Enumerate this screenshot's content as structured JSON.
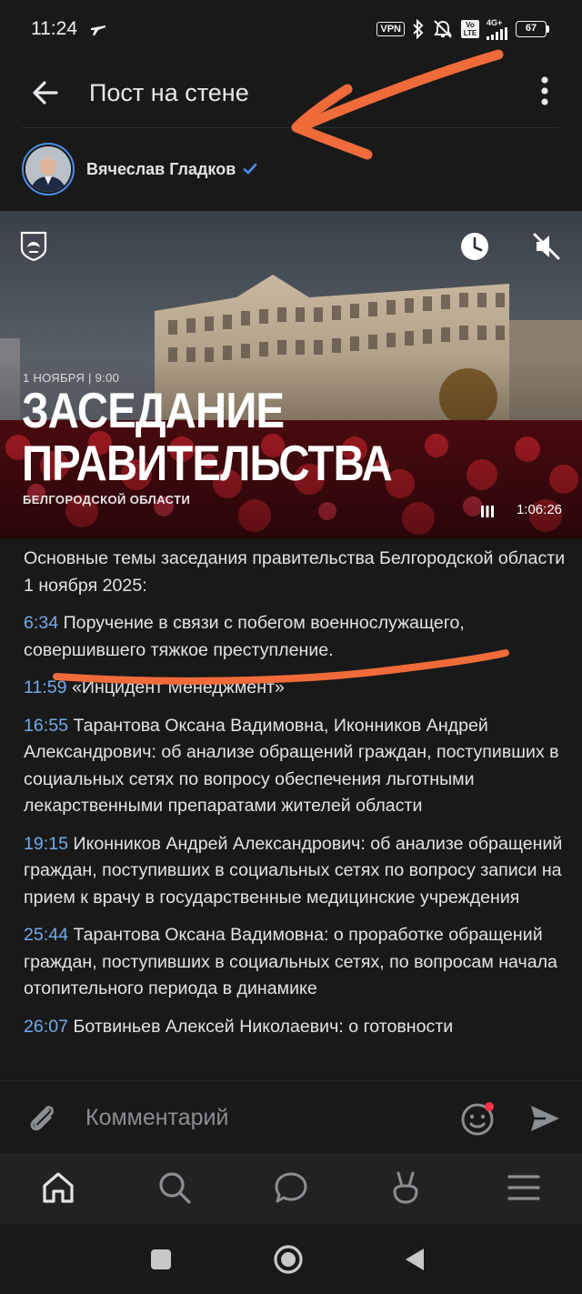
{
  "status_bar": {
    "time": "11:24",
    "vpn": "VPN",
    "volte": "Vo LTE",
    "network": "4G+",
    "battery": "67"
  },
  "header": {
    "title": "Пост на стене"
  },
  "author": {
    "name": "Вячеслав Гладков"
  },
  "video": {
    "date": "1 НОЯБРЯ | 9:00",
    "title_line1": "ЗАСЕДАНИЕ",
    "title_line2": "ПРАВИТЕЛЬСТВА",
    "subtitle": "БЕЛГОРОДСКОЙ ОБЛАСТИ",
    "duration": "1:06:26"
  },
  "post": {
    "intro": "Основные темы заседания правительства Белгородской области 1 ноября 2025:",
    "items": [
      {
        "time": "6:34",
        "text": " Поручение в связи с побегом военнослужащего, совершившего тяжкое преступление."
      },
      {
        "time": "11:59",
        "text": " «Инцидент Менеджмент»"
      },
      {
        "time": "16:55",
        "text": " Тарантова Оксана Вадимовна, Иконников Андрей Александрович: об анализе обращений граждан, поступивших в социальных сетях по вопросу обеспечения льготными лекарственными препаратами жителей области"
      },
      {
        "time": "19:15",
        "text": " Иконников Андрей Александрович: об анализе обращений граждан, поступивших в социальных сетях по вопросу записи на прием к врачу в государственные медицинские учреждения"
      },
      {
        "time": "25:44",
        "text": " Тарантова Оксана Вадимовна: о проработке обращений граждан, поступивших в социальных сетях, по вопросам начала отопительного периода в динамике"
      },
      {
        "time": "26:07",
        "text": " Ботвиньев Алексей Николаевич: о готовности"
      }
    ]
  },
  "comment": {
    "placeholder": "Комментарий"
  },
  "colors": {
    "background": "#191919",
    "link": "#71aaeb",
    "annotation": "#f06b3a",
    "verified": "#4a8de8"
  }
}
